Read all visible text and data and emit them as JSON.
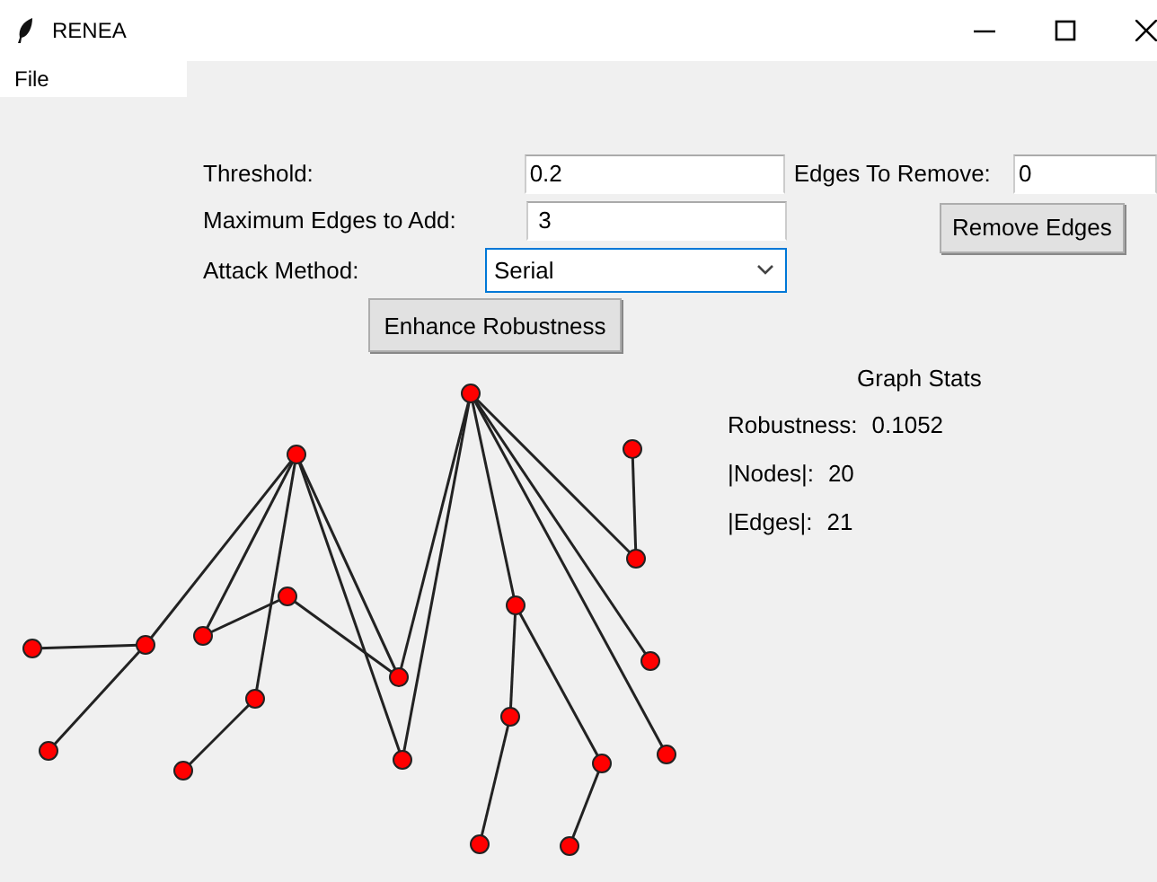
{
  "window": {
    "title": "RENEA"
  },
  "menu": [
    "File"
  ],
  "form": {
    "threshold": {
      "label": "Threshold:",
      "value": "0.2"
    },
    "max_edges": {
      "label": "Maximum Edges to Add:",
      "value": " 3"
    },
    "attack_method": {
      "label": "Attack Method:",
      "value": "Serial"
    },
    "edges_to_remove": {
      "label": "Edges To Remove:",
      "value": "0"
    },
    "buttons": [
      "Enhance Robustness",
      "Remove Edges"
    ]
  },
  "graph_stats": {
    "title": "Graph Stats",
    "rows": [
      {
        "label": "Robustness:",
        "value": "0.1052"
      },
      {
        "label": "|Nodes|:",
        "value": "20"
      },
      {
        "label": "|Edges|:",
        "value": "21"
      }
    ]
  }
}
